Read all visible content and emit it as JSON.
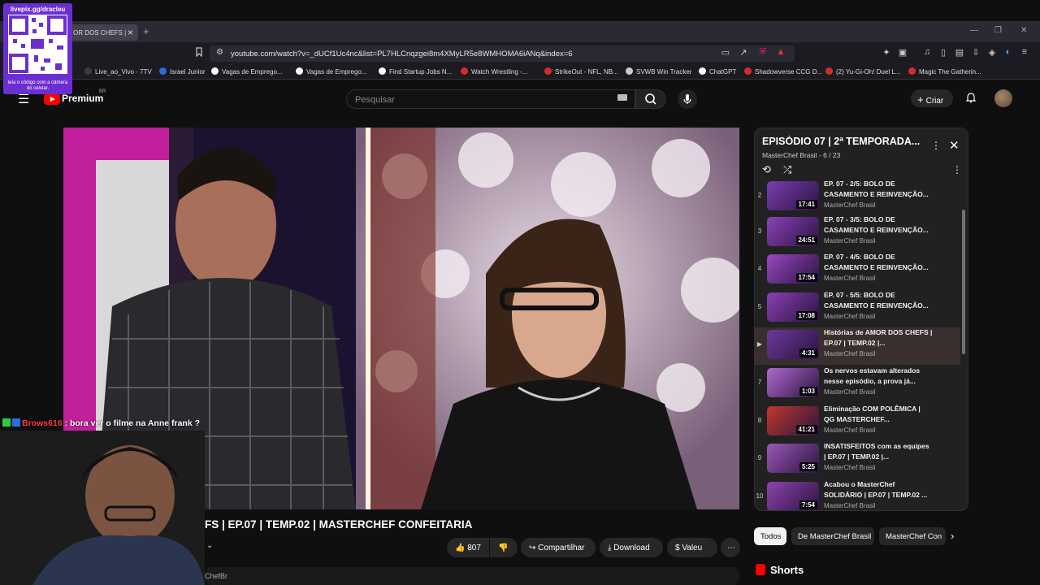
{
  "browser": {
    "tab_title": "OR DOS CHEFS |",
    "url": "youtube.com/watch?v=_dUCf1Uc4nc&list=PL7HLCnqzgei8m4XMyLR5e8WMHOMA6iANq&index=6",
    "bookmarks": [
      {
        "label": "Live_ao_Vivo - 7TV",
        "color": "#3a3a3a"
      },
      {
        "label": "Israel Junior",
        "color": "#2b6cd6"
      },
      {
        "label": "Vagas de Emprego...",
        "color": "#ffffff"
      },
      {
        "label": "Vagas de Emprego...",
        "color": "#ffffff"
      },
      {
        "label": "Find Startup Jobs N...",
        "color": "#ffffff"
      },
      {
        "label": "Watch Wrestling -...",
        "color": "#d62b2b"
      },
      {
        "label": "StrikeOut - NFL, NB...",
        "color": "#d62b2b"
      },
      {
        "label": "SVWB Win Tracker",
        "color": "#cccccc"
      },
      {
        "label": "ChatGPT",
        "color": "#ffffff"
      },
      {
        "label": "Shadowverse CCG D...",
        "color": "#d62b2b"
      },
      {
        "label": "(2) Yu-Gi-Oh! Duel L...",
        "color": "#d62b2b"
      },
      {
        "label": "Magic The Gatherin...",
        "color": "#d62b2b"
      }
    ]
  },
  "header": {
    "premium": "Premium",
    "region": "BR",
    "search_placeholder": "Pesquisar",
    "create_label": "Criar"
  },
  "video": {
    "title": "FS | EP.07 | TEMP.02 | MASTERCHEF CONFEITARIA",
    "likes": "807",
    "share_label": "Compartilhar",
    "download_label": "Download",
    "thanks_label": "Valeu",
    "channel_fragment": "ChefBr"
  },
  "playlist": {
    "title": "EPISÓDIO 07 | 2ª TEMPORADA...",
    "subtitle": "MasterChef Brasil - 6 / 23",
    "items": [
      {
        "index": "2",
        "title": "EP. 07 - 2/5: BOLO DE CASAMENTO E REINVENÇÃO...",
        "channel": "MasterChef Brasil",
        "duration": "17:41",
        "thumb": "#7a3fb0"
      },
      {
        "index": "3",
        "title": "EP. 07 - 3/5: BOLO DE CASAMENTO E REINVENÇÃO...",
        "channel": "MasterChef Brasil",
        "duration": "24:51",
        "thumb": "#8a42b8"
      },
      {
        "index": "4",
        "title": "EP. 07 - 4/5: BOLO DE CASAMENTO E REINVENÇÃO...",
        "channel": "MasterChef Brasil",
        "duration": "17:54",
        "thumb": "#9a48c2"
      },
      {
        "index": "5",
        "title": "EP. 07 - 5/5: BOLO DE CASAMENTO E REINVENÇÃO...",
        "channel": "MasterChef Brasil",
        "duration": "17:08",
        "thumb": "#8a40b5"
      },
      {
        "index": "▶",
        "title": "Histórias de AMOR DOS CHEFS | EP.07 | TEMP.02 |...",
        "channel": "MasterChef Brasil",
        "duration": "4:31",
        "thumb": "#6b3a9a",
        "active": true
      },
      {
        "index": "7",
        "title": "Os nervos estavam alterados nesse episódio, a prova já...",
        "channel": "MasterChef Brasil",
        "duration": "1:03",
        "thumb": "#b06ad0"
      },
      {
        "index": "8",
        "title": "Eliminação COM POLÊMICA | QG MASTERCHEF...",
        "channel": "MasterChef Brasil",
        "duration": "41:21",
        "thumb": "#c0392b"
      },
      {
        "index": "9",
        "title": "INSATISFEITOS com as equipes | EP.07 | TEMP.02 |...",
        "channel": "MasterChef Brasil",
        "duration": "5:25",
        "thumb": "#9b59b6"
      },
      {
        "index": "10",
        "title": "Acabou o MasterChef SOLIDÁRIO | EP.07 | TEMP.02 ...",
        "channel": "MasterChef Brasil",
        "duration": "7:54",
        "thumb": "#8e44ad"
      }
    ]
  },
  "chips": [
    "Todos",
    "De MasterChef Brasil",
    "MasterChef Con"
  ],
  "shorts_label": "Shorts",
  "overlay": {
    "qr_url": "livepix.gg/dracleu",
    "qr_caption": "leia o código com a câmera do celular.",
    "chat_user": "Brows616",
    "chat_message": " : bora ver o filme na Anne frank ?"
  }
}
